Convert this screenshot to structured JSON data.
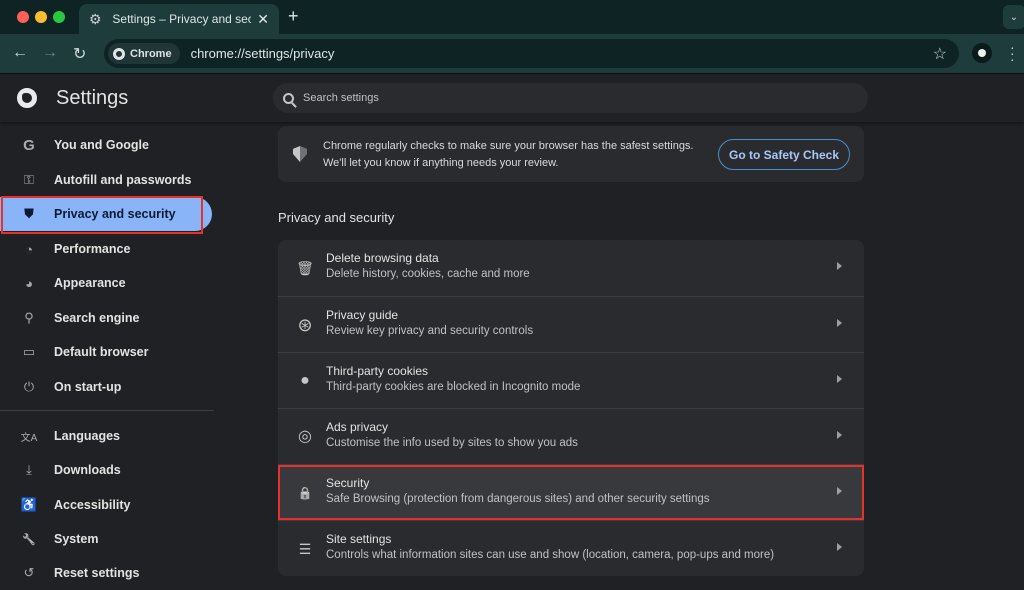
{
  "window": {
    "tab_title": "Settings – Privacy and securit",
    "tab_icon": "gear-icon",
    "new_tab_label": "+",
    "address_chip": "Chrome",
    "url": "chrome://settings/privacy"
  },
  "header": {
    "title": "Settings",
    "search_placeholder": "Search settings"
  },
  "sidebar": {
    "items": [
      {
        "label": "You and Google",
        "icon": "google-g-icon",
        "glyph": "G"
      },
      {
        "label": "Autofill and passwords",
        "icon": "key-icon",
        "glyph": "⚿"
      },
      {
        "label": "Privacy and security",
        "icon": "shield-icon",
        "glyph": "⛊",
        "active": true
      },
      {
        "label": "Performance",
        "icon": "speedometer-icon",
        "glyph": "◔"
      },
      {
        "label": "Appearance",
        "icon": "palette-icon",
        "glyph": "◕"
      },
      {
        "label": "Search engine",
        "icon": "search-icon",
        "glyph": "⚲"
      },
      {
        "label": "Default browser",
        "icon": "browser-window-icon",
        "glyph": "▭"
      },
      {
        "label": "On start-up",
        "icon": "power-icon",
        "glyph": "⏻"
      },
      {
        "label": "Languages",
        "icon": "translate-icon",
        "glyph": "文A"
      },
      {
        "label": "Downloads",
        "icon": "download-icon",
        "glyph": "⤓"
      },
      {
        "label": "Accessibility",
        "icon": "accessibility-icon",
        "glyph": "♿"
      },
      {
        "label": "System",
        "icon": "wrench-icon",
        "glyph": "🔧"
      },
      {
        "label": "Reset settings",
        "icon": "reset-icon",
        "glyph": "↺"
      }
    ]
  },
  "safety_check": {
    "message": "Chrome regularly checks to make sure your browser has the safest settings. We'll let you know if anything needs your review.",
    "button_label": "Go to Safety Check"
  },
  "section": {
    "title": "Privacy and security",
    "rows": [
      {
        "title": "Delete browsing data",
        "subtitle": "Delete history, cookies, cache and more",
        "icon": "trash-icon",
        "glyph": "🗑"
      },
      {
        "title": "Privacy guide",
        "subtitle": "Review key privacy and security controls",
        "icon": "compass-icon",
        "glyph": "⊛"
      },
      {
        "title": "Third-party cookies",
        "subtitle": "Third-party cookies are blocked in Incognito mode",
        "icon": "cookie-icon",
        "glyph": "●"
      },
      {
        "title": "Ads privacy",
        "subtitle": "Customise the info used by sites to show you ads",
        "icon": "ads-target-icon",
        "glyph": "◎"
      },
      {
        "title": "Security",
        "subtitle": "Safe Browsing (protection from dangerous sites) and other security settings",
        "icon": "lock-icon",
        "glyph": "🔒",
        "highlighted": true
      },
      {
        "title": "Site settings",
        "subtitle": "Controls what information sites can use and show (location, camera, pop-ups and more)",
        "icon": "sliders-icon",
        "glyph": "☰"
      }
    ]
  },
  "colors": {
    "accent": "#8ab4f8",
    "highlight_border": "#e5332a",
    "button_text": "#a8c7fa"
  }
}
